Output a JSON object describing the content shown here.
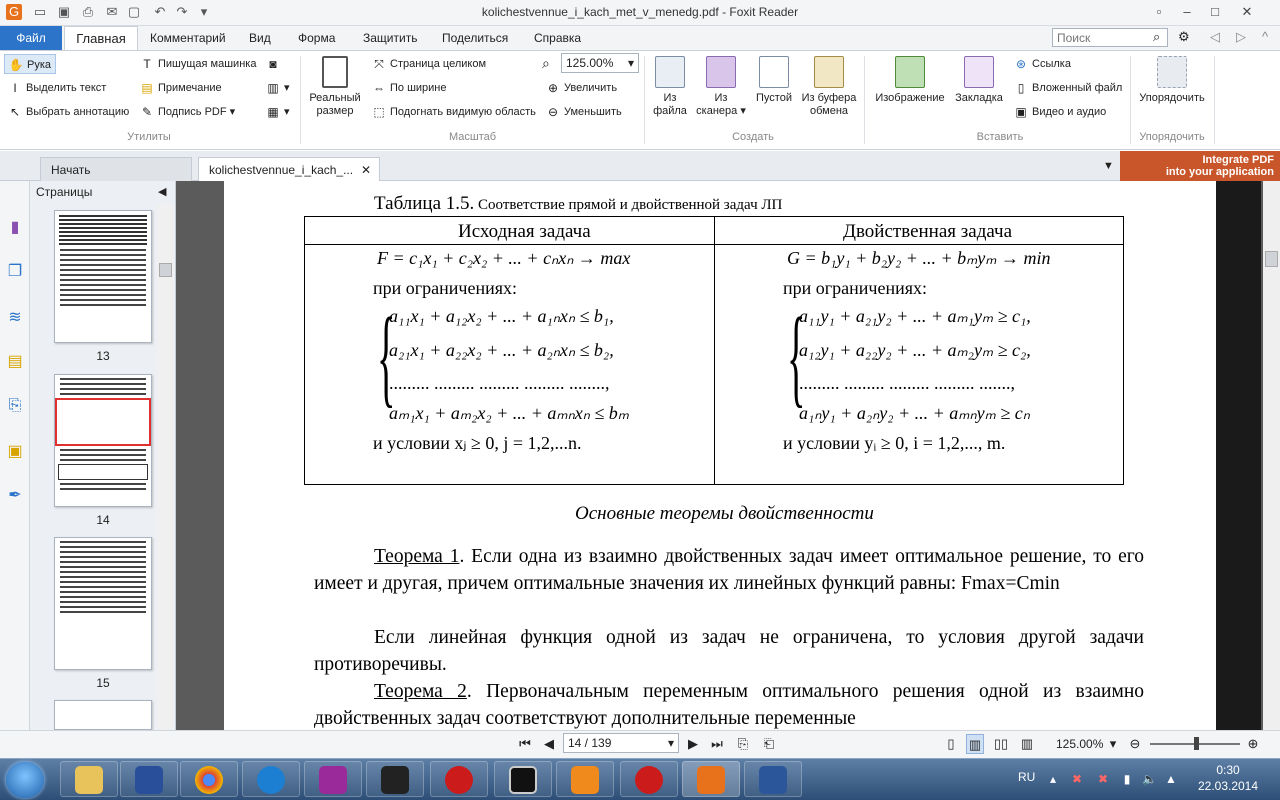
{
  "app": {
    "title": "kolichestvennue_i_kach_met_v_menedg.pdf - Foxit Reader",
    "quick_access": [
      "save-icon",
      "open-icon",
      "print-icon",
      "email-icon",
      "undo-icon",
      "redo-icon"
    ]
  },
  "menu": {
    "file": "Файл",
    "tabs": [
      "Главная",
      "Комментарий",
      "Вид",
      "Форма",
      "Защитить",
      "Поделиться",
      "Справка"
    ],
    "search_placeholder": "Поиск"
  },
  "ribbon": {
    "utilities": {
      "hand": "Рука",
      "select_text": "Выделить текст",
      "select_annotation": "Выбрать аннотацию",
      "typewriter": "Пишущая машинка",
      "note": "Примечание",
      "sign_pdf": "Подпись PDF",
      "group": "Утилиты"
    },
    "scale": {
      "actual_size": "Реальный размер",
      "fit_page": "Страница целиком",
      "fit_width": "По ширине",
      "fit_visible": "Подогнать видимую область",
      "zoom_value": "125.00%",
      "zoom_in": "Увеличить",
      "zoom_out": "Уменьшить",
      "group": "Масштаб"
    },
    "create": {
      "from_file": "Из файла",
      "from_scanner": "Из сканера",
      "blank": "Пустой",
      "from_clipboard": "Из буфера обмена",
      "group": "Создать"
    },
    "insert": {
      "image": "Изображение",
      "bookmark": "Закладка",
      "link": "Ссылка",
      "attachment": "Вложенный файл",
      "video_audio": "Видео и аудио",
      "group": "Вставить"
    },
    "arrange": {
      "arrange": "Упорядочить",
      "group": "Упорядочить"
    }
  },
  "tabs": {
    "start": "Начать",
    "document": "kolichestvennue_i_kach_..."
  },
  "banner": {
    "line1": "Integrate PDF",
    "line2": "into your application"
  },
  "pages_panel": {
    "title": "Страницы",
    "page_numbers": [
      "13",
      "14",
      "15"
    ]
  },
  "document": {
    "table_caption_main": "Таблица 1.5.",
    "table_caption_rest": " Соответствие прямой и двойственной задач ЛП",
    "col1_header": "Исходная задача",
    "col2_header": "Двойственная задача",
    "left": {
      "objective": "F = c₁x₁ + c₂x₂ + ... + cₙxₙ → max",
      "constraints_label": "при ограничениях:",
      "rows": [
        "a₁₁x₁ + a₁₂x₂ + ... + a₁ₙxₙ ≤ b₁,",
        "a₂₁x₁ + a₂₂x₂ + ... + a₂ₙxₙ ≤ b₂,",
        "......... ......... ......... ......... ........,",
        "aₘ₁x₁ + aₘ₂x₂ + ... + aₘₙxₙ ≤ bₘ"
      ],
      "condition": "и условии    xⱼ ≥ 0, j = 1,2,...n."
    },
    "right": {
      "objective": "G = b₁y₁ + b₂y₂ + ... + bₘyₘ → min",
      "constraints_label": "при ограничениях:",
      "rows": [
        "a₁₁y₁ + a₂₁y₂ + ... + aₘ₁yₘ ≥ c₁,",
        "a₁₂y₁ + a₂₂y₂ + ... + aₘ₂yₘ ≥ c₂,",
        "......... ......... ......... ......... .......,",
        "a₁ₙy₁ + a₂ₙy₂ + ... + aₘₙyₘ ≥ cₙ"
      ],
      "condition": "и условии   yᵢ ≥ 0, i = 1,2,..., m."
    },
    "heading": "Основные теоремы двойственности",
    "theorem1_label": "Теорема 1",
    "theorem1_text": ". Если одна из взаимно двойственных задач имеет оптимальное решение, то его имеет и другая, причем оптимальные значения их линейных функций равны:     Fmax=Cmin",
    "para2": "Если линейная функция одной из задач не ограничена, то условия другой задачи противоречивы.",
    "theorem2_label": "Теорема 2",
    "theorem2_text": ". Первоначальным переменным оптимального решения одной из взаимно двойственных задач соответствуют дополнительные переменные"
  },
  "statusbar": {
    "page_value": "14 / 139",
    "zoom": "125.00%"
  },
  "taskbar": {
    "language": "RU",
    "time": "0:30",
    "date": "22.03.2014"
  }
}
